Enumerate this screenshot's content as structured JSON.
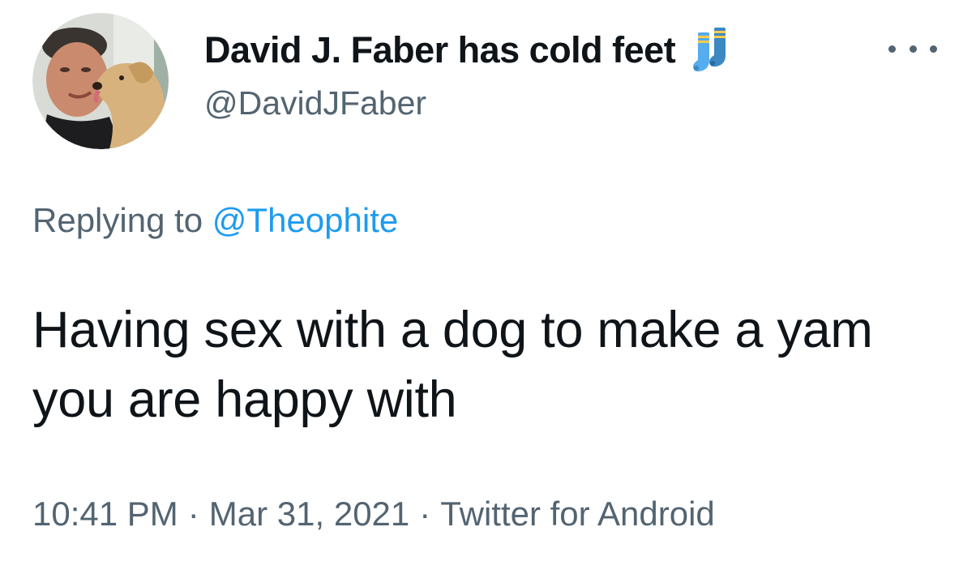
{
  "author": {
    "display_name": "David J. Faber has cold feet",
    "name_emoji": "socks-icon",
    "handle": "@DavidJFaber",
    "avatar": "profile-photo-man-with-dog"
  },
  "reply": {
    "prefix": "Replying to",
    "target": "@Theophite"
  },
  "tweet": {
    "text": "Having sex with a dog to make a yam you are happy with",
    "time": "10:41 PM",
    "separator": "·",
    "date": "Mar 31, 2021",
    "source": "Twitter for Android"
  },
  "menu": {
    "icon": "more-options-icon"
  },
  "colors": {
    "text_primary": "#0f1419",
    "text_secondary": "#536471",
    "link": "#1d9bf0",
    "sock_blue": "#3b88c3",
    "sock_stripe": "#ffcc4d"
  }
}
